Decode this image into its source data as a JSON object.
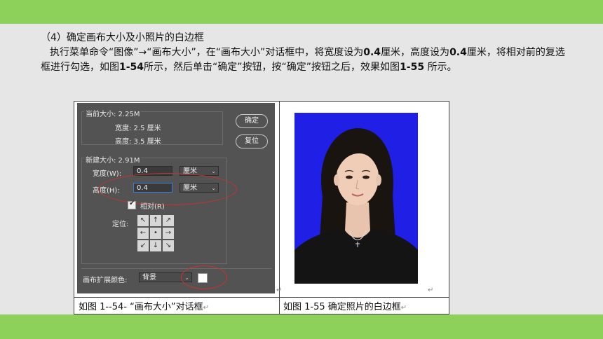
{
  "text": {
    "heading": "（4）确定画布大小及小照片的白边框",
    "para_parts": [
      "执行菜单命令“图像”→“画布大小”，在“画布大小”对话框中，将宽度设为",
      "0.4",
      "厘米，高度设为",
      "0.4",
      "厘米，将相对前的复选框进行勾选，如图",
      "1-54",
      "所示，然后单击“确定”按钮，按“确定”按钮之后，效果如图",
      "1-55",
      " 所示。"
    ]
  },
  "dialog": {
    "current_size": "当前大小: 2.25M",
    "current_width": "宽度:  2.5 厘米",
    "current_height": "高度:  3.5 厘米",
    "ok_button": "确定",
    "reset_button": "复位",
    "new_size": "新建大小: 2.91M",
    "width_label": "宽度(W):",
    "width_value": "0.4",
    "width_unit": "厘米",
    "height_label": "高度(H):",
    "height_value": "0.4",
    "height_unit": "厘米",
    "relative_label": "相对(R)",
    "anchor_label": "定位:",
    "anchor_glyphs": [
      "↖",
      "↑",
      "↗",
      "←",
      "•",
      "→",
      "↙",
      "↓",
      "↘"
    ],
    "extension_color_label": "画布扩展颜色:",
    "extension_color_value": "背景"
  },
  "captions": {
    "left": "如图 1--54- “画布大小”对话框",
    "right": "如图 1-55  确定照片的白边框",
    "return_mark": "↵"
  },
  "colors": {
    "accent_green": "#8ed15a",
    "dialog_bg": "#535353",
    "photo_bg": "#1f1fe6",
    "highlight_red": "#c83232"
  }
}
